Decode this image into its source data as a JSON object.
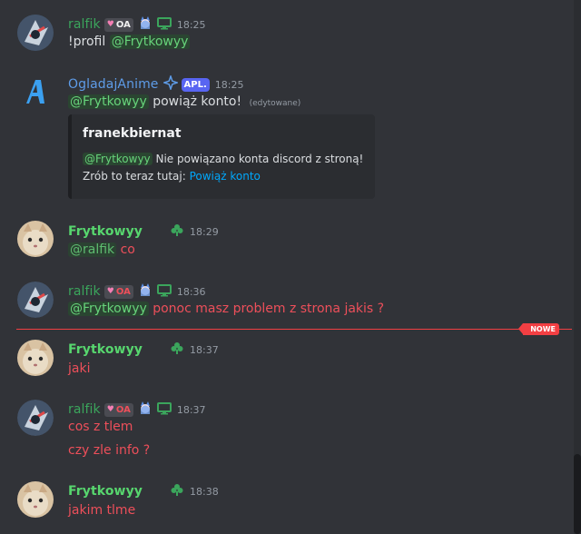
{
  "messages": [
    {
      "author": "ralfik",
      "badge": "OA",
      "time": "18:25",
      "lines": [
        "!profil",
        "@Frytkowyy"
      ]
    },
    {
      "author": "OgladajAnime",
      "badge": "APL.",
      "time": "18:25",
      "mention": "@Frytkowyy",
      "text": "powiąż konto!",
      "edited": "(edytowane)",
      "embed": {
        "title": "franekbiernat",
        "mention": "@Frytkowyy",
        "line1": "Nie powiązano konta discord z stroną!",
        "line2_prefix": "Zrób to teraz tutaj:",
        "link": "Powiąż konto"
      }
    },
    {
      "author": "Frytkowyy",
      "time": "18:29",
      "mention": "@ralfik",
      "text": "co"
    },
    {
      "author": "ralfik",
      "badge": "OA",
      "time": "18:36",
      "mention": "@Frytkowyy",
      "text": "ponoc masz problem z strona jakis ?"
    },
    {
      "author": "Frytkowyy",
      "time": "18:37",
      "text": "jaki"
    },
    {
      "author": "ralfik",
      "badge": "OA",
      "time": "18:37",
      "lines": [
        "cos z tlem",
        "czy zle info ?"
      ]
    },
    {
      "author": "Frytkowyy",
      "time": "18:38",
      "text": "jakim tlme"
    }
  ],
  "new_divider": "NOWE",
  "colors": {
    "ralfik": "#3ba55c",
    "frytkowyy": "#57d66e",
    "ogladaj": "#5865f2",
    "text_red": "#ed4f5a",
    "mention_green": "#67d37a"
  }
}
